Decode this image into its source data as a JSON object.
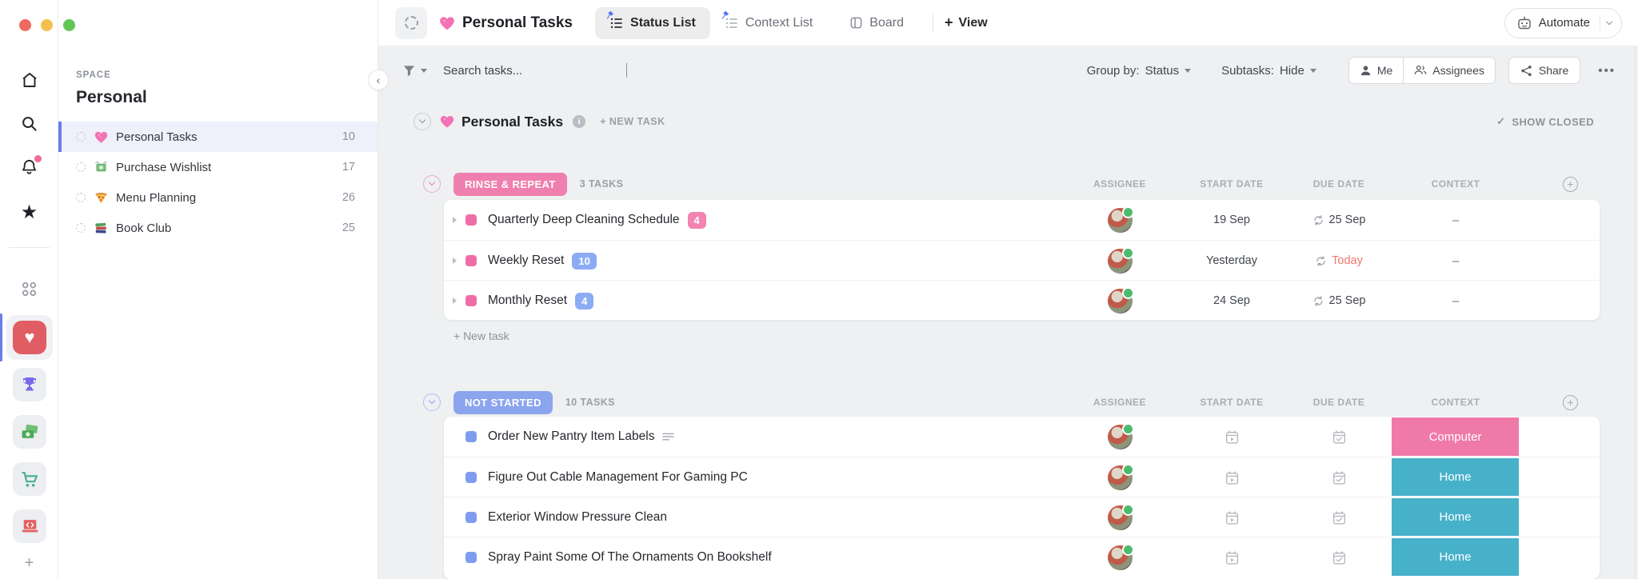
{
  "window": {
    "buttons": [
      "close",
      "minimize",
      "zoom"
    ]
  },
  "rail": {
    "nav_icons": [
      "home",
      "search",
      "notifications",
      "favorites"
    ],
    "spaces": [
      "personal-heart",
      "trophy",
      "money",
      "cart",
      "laptop"
    ],
    "add_label": "+"
  },
  "sidebar": {
    "section_label": "SPACE",
    "space_title": "Personal",
    "items": [
      {
        "label": "Personal Tasks",
        "count": "10",
        "icon": "sparkling-heart",
        "selected": true
      },
      {
        "label": "Purchase Wishlist",
        "count": "17",
        "icon": "money-with-wings",
        "selected": false
      },
      {
        "label": "Menu Planning",
        "count": "26",
        "icon": "pizza",
        "selected": false
      },
      {
        "label": "Book Club",
        "count": "25",
        "icon": "books",
        "selected": false
      }
    ]
  },
  "header": {
    "title": "Personal Tasks",
    "tabs": [
      {
        "label": "Status List",
        "pinned": true,
        "active": true
      },
      {
        "label": "Context List",
        "pinned": true,
        "active": false
      },
      {
        "label": "Board",
        "pinned": false,
        "active": false
      }
    ],
    "add_view_plus": "+",
    "add_view_label": "View",
    "automate_label": "Automate"
  },
  "toolbar": {
    "search_placeholder": "Search tasks...",
    "group_by_label": "Group by:",
    "group_by_value": "Status",
    "subtasks_label": "Subtasks:",
    "subtasks_value": "Hide",
    "me_label": "Me",
    "assignees_label": "Assignees",
    "share_label": "Share",
    "more_label": "•••"
  },
  "list_header": {
    "title": "Personal Tasks",
    "new_task_label": "+ NEW TASK",
    "show_closed_check": "✓",
    "show_closed_label": "SHOW CLOSED"
  },
  "columns": {
    "assignee": "ASSIGNEE",
    "start": "START DATE",
    "due": "DUE DATE",
    "context": "CONTEXT"
  },
  "groups": [
    {
      "name": "RINSE & REPEAT",
      "color": "#ef7fae",
      "count_label": "3 TASKS",
      "footer_label": "+ New task",
      "tasks": [
        {
          "name": "Quarterly Deep Cleaning Schedule",
          "subtask_count": "4",
          "badge_color": "#f383b0",
          "start": "19 Sep",
          "due": "25 Sep",
          "due_color": "#42464d",
          "context": "–"
        },
        {
          "name": "Weekly Reset",
          "subtask_count": "10",
          "badge_color": "#8bacf4",
          "start": "Yesterday",
          "due": "Today",
          "due_color": "#f3756c",
          "context": "–"
        },
        {
          "name": "Monthly Reset",
          "subtask_count": "4",
          "badge_color": "#8bacf4",
          "start": "24 Sep",
          "due": "25 Sep",
          "due_color": "#42464d",
          "context": "–"
        }
      ]
    },
    {
      "name": "NOT STARTED",
      "color": "#8ba4ee",
      "count_label": "10 TASKS",
      "tasks": [
        {
          "name": "Order New Pantry Item Labels",
          "has_description": true,
          "context": "Computer",
          "context_color": "#ef7aa8"
        },
        {
          "name": "Figure Out Cable Management For Gaming PC",
          "has_description": false,
          "context": "Home",
          "context_color": "#47b1c9"
        },
        {
          "name": "Exterior Window Pressure Clean",
          "has_description": false,
          "context": "Home",
          "context_color": "#47b1c9"
        },
        {
          "name": "Spray Paint Some Of The Ornaments On Bookshelf",
          "has_description": false,
          "context": "Home",
          "context_color": "#47b1c9"
        }
      ]
    }
  ],
  "colors": {
    "accent": "#6b7de8",
    "status_pink": "#ee6da6",
    "status_blue": "#7f9dee"
  }
}
